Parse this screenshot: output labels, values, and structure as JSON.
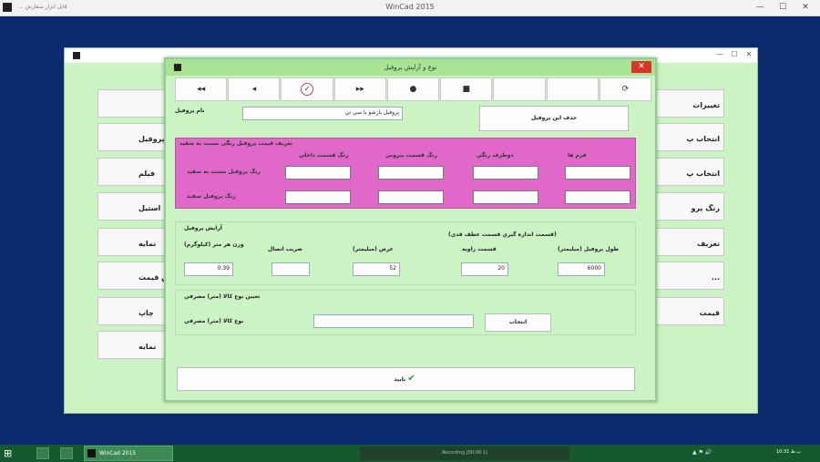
{
  "app": {
    "title": "WinCad 2015",
    "menu": "فايل  ابزار  سفارش  ...",
    "min": "—",
    "max": "☐",
    "close": "✕"
  },
  "bg_dialog": {
    "min": "—",
    "max": "☐",
    "close": "✕",
    "left_buttons": [
      "",
      "پروفيل",
      "فيلم",
      "استيل",
      "نمايه",
      "نمايش قيمت",
      "چاپ",
      "نمايه"
    ],
    "right_buttons": [
      "تغييرات",
      "انتخاب پ",
      "انتخاب پ",
      "رنگ پرو",
      "تعريف",
      "...",
      "قيمت"
    ]
  },
  "dialog": {
    "title": "نوع و آرايش پروفيل",
    "close": "✕",
    "toolbar": [
      "◂◂",
      "◂",
      "✓",
      "▸▸",
      "●",
      "■",
      "",
      "",
      "⟳"
    ],
    "profile_name_label": "نام پروفيل",
    "profile_name_value": "پروفيل بازشو با سي تي",
    "delete_button": "حذف اين پروفيل",
    "color_group_title": "تعريف قيمت پروفيل رنگي نسبت به سفيد",
    "color_headers": [
      "رنگ قسمت داخلي",
      "رنگ قسمت بيروني",
      "دوطرف رنگي",
      "فرم ها"
    ],
    "color_row_labels": [
      "رنگ پروفيل نسبت به سفيد",
      "رنگ پروفيل سفيد"
    ],
    "arrangement_title": "آرايش پروفيل",
    "arrangement_note": "(قسمت اندازه گيري قسمت عطف قدي)",
    "arrangement_headers": [
      "وزن هر متر (كيلوگرم)",
      "ضريب اتصال",
      "عرض (ميليمتر)",
      "قسمت زاويه",
      "طول پروفيل (ميليمتر)"
    ],
    "arrangement_values": [
      "0.39",
      "",
      "52",
      "20",
      "6000"
    ],
    "glass_group_title": "تعيين نوع كالا (متر) مصرفي",
    "glass_label": "نوع كالا (متر) مصرفي",
    "glass_value": "",
    "select_button": "انتخاب",
    "ok_button": "تاييد",
    "ok_icon": "✔"
  },
  "taskbar": {
    "start": "⊞",
    "app_label": "WinCad 2015",
    "recording": "Recording [00:00:1]",
    "tray": "▲ ⚑ 🔊",
    "clock": "10:31 ب.ظ"
  }
}
